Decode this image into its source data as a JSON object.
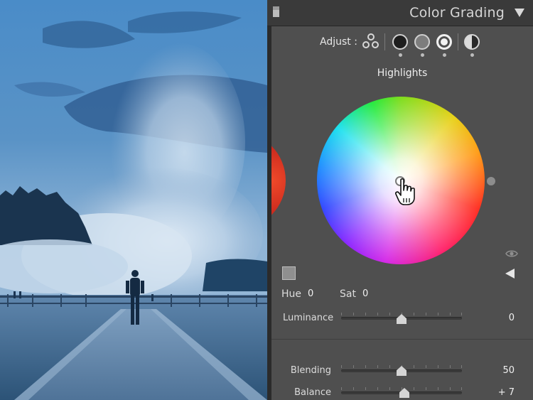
{
  "panel": {
    "title": "Color Grading",
    "collapse_icon": "triangle-down-icon"
  },
  "adjust": {
    "label": "Adjust :",
    "modes": [
      {
        "name": "3-way",
        "icon": "three-circles-icon"
      },
      {
        "name": "Shadows",
        "icon": "shadows-wheel-icon"
      },
      {
        "name": "Midtones",
        "icon": "midtones-wheel-icon"
      },
      {
        "name": "Highlights",
        "icon": "highlights-wheel-icon",
        "selected": true
      },
      {
        "name": "Global",
        "icon": "global-half-circle-icon"
      }
    ]
  },
  "wheel": {
    "title": "Highlights",
    "hue_label": "Hue",
    "hue_value": "0",
    "sat_label": "Sat",
    "sat_value": "0"
  },
  "sliders": {
    "luminance": {
      "label": "Luminance",
      "value": "0"
    },
    "blending": {
      "label": "Blending",
      "value": "50"
    },
    "balance": {
      "label": "Balance",
      "value": "+ 7"
    }
  },
  "colors": {
    "panel_bg": "#4f4f4f",
    "header_bg": "#3a3a3a",
    "photo_tint": "#3f79b0"
  }
}
